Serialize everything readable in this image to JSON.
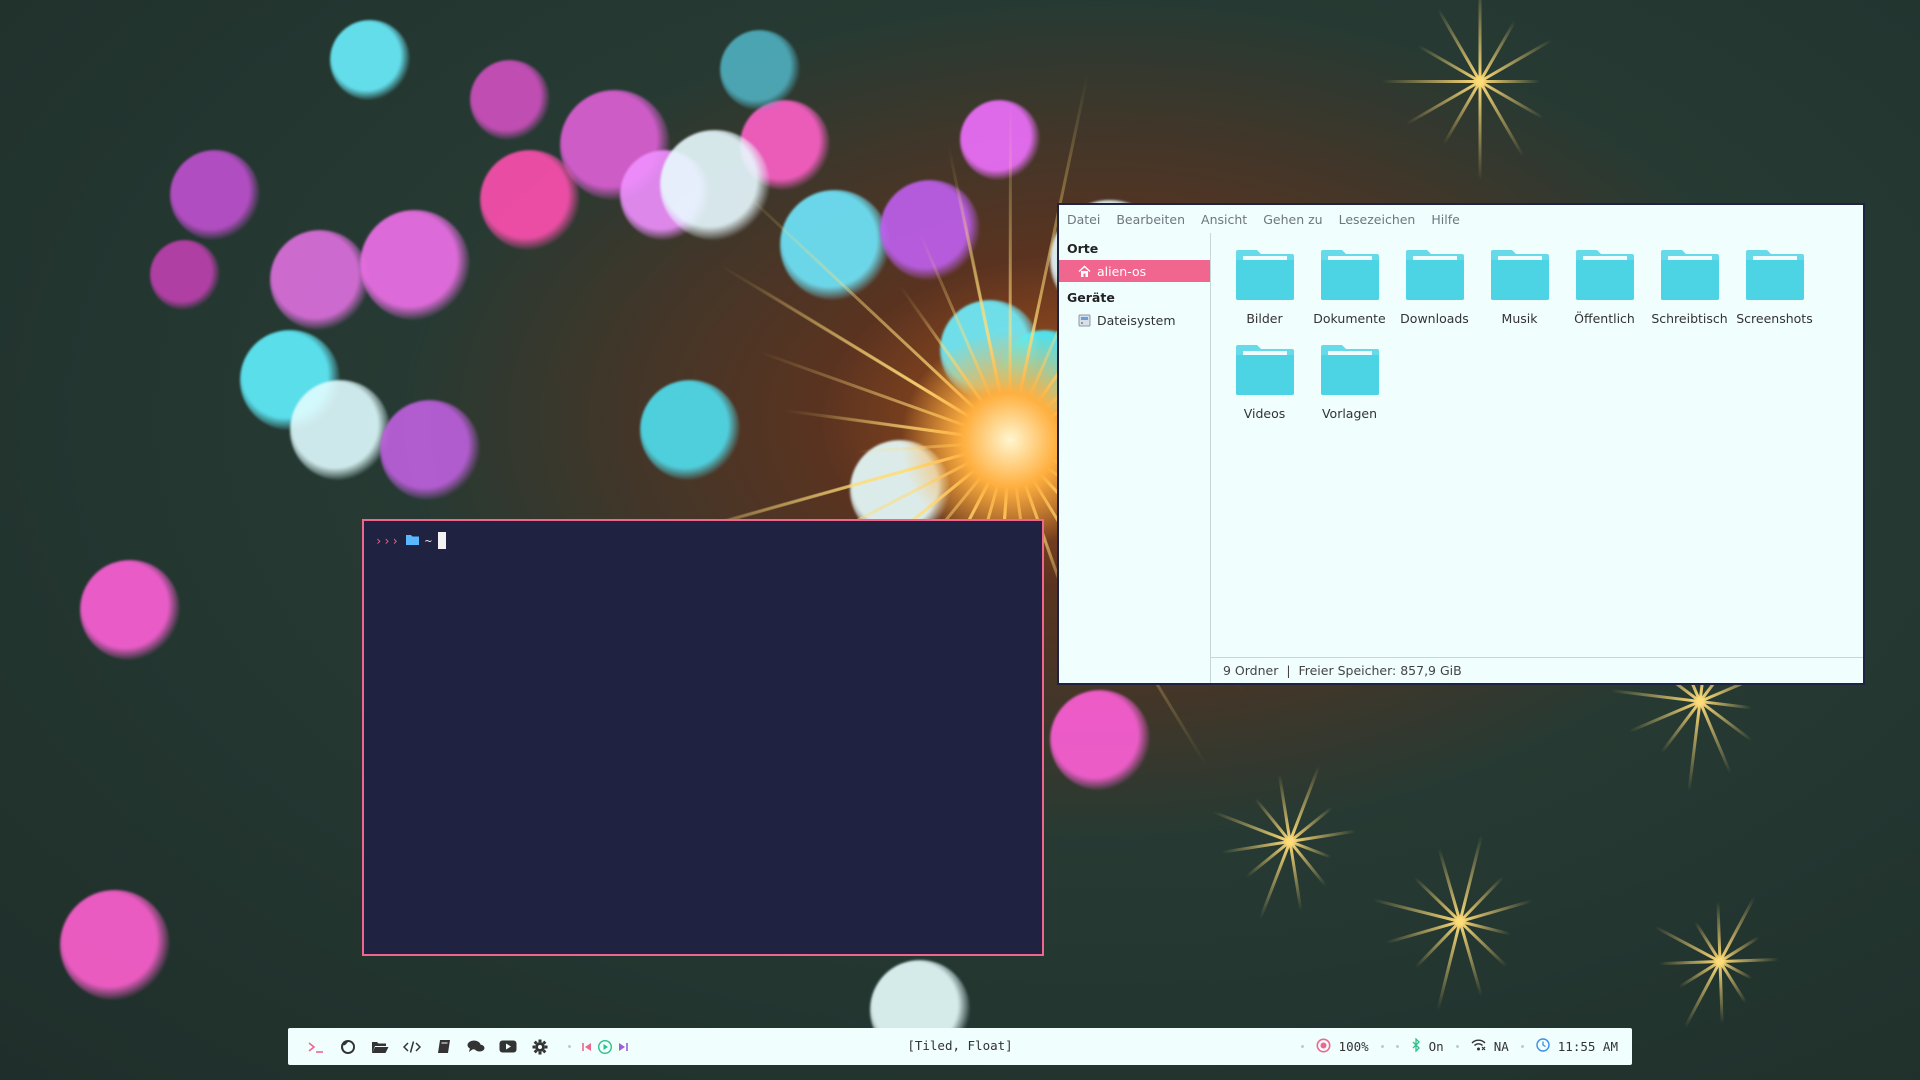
{
  "file_manager": {
    "menu": [
      "Datei",
      "Bearbeiten",
      "Ansicht",
      "Gehen zu",
      "Lesezeichen",
      "Hilfe"
    ],
    "sidebar": {
      "places_heading": "Orte",
      "places": [
        {
          "label": "alien-os",
          "icon": "home-icon",
          "active": true
        }
      ],
      "devices_heading": "Geräte",
      "devices": [
        {
          "label": "Dateisystem",
          "icon": "drive-icon"
        }
      ]
    },
    "folders": [
      "Bilder",
      "Dokumente",
      "Downloads",
      "Musik",
      "Öffentlich",
      "Schreibtisch",
      "Screenshots",
      "Videos",
      "Vorlagen"
    ],
    "status": "9 Ordner  |  Freier Speicher: 857,9 GiB",
    "folder_color": "#4dd4e4",
    "accent": "#f0668f"
  },
  "terminal": {
    "prompt_arrows": "›››",
    "path": "~",
    "prompt_color": "#f0668f",
    "folder_icon_color": "#5ab8ff"
  },
  "bar": {
    "layout_label": "[Tiled, Float]",
    "launchers": [
      "terminal-icon",
      "firefox-icon",
      "folder-open-icon",
      "code-icon",
      "book-icon",
      "chat-icon",
      "youtube-icon",
      "gear-icon"
    ],
    "media": [
      "previous-icon",
      "play-icon",
      "next-icon"
    ],
    "volume": "100%",
    "bluetooth": "On",
    "wifi": "NA",
    "clock": "11:55 AM"
  }
}
